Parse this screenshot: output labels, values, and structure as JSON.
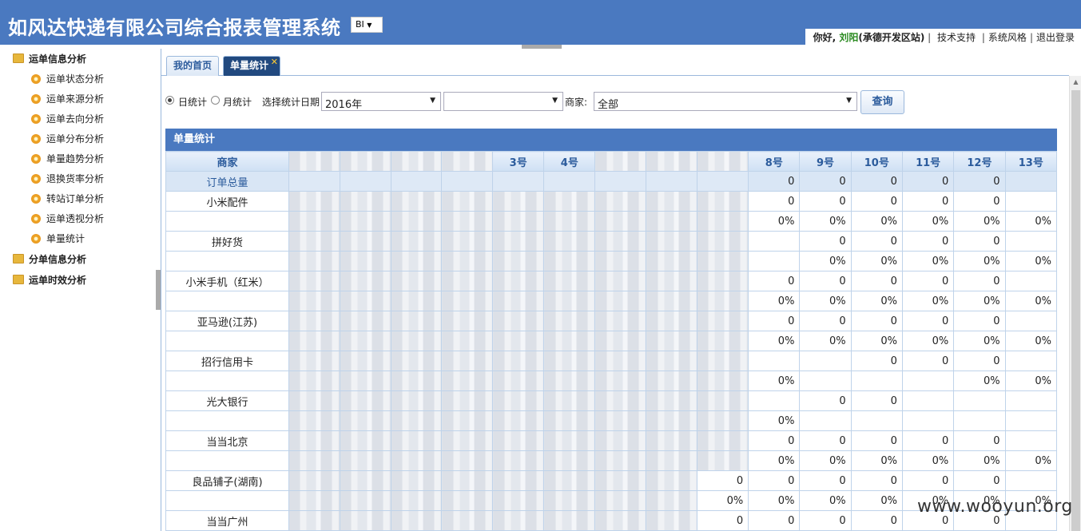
{
  "header": {
    "title": "如风达快递有限公司综合报表管理系统",
    "bi_select": "BI",
    "greeting": "你好, ",
    "user_name": "刘阳",
    "user_site": "(承德开发区站)",
    "links": [
      "技术支持",
      "系统风格",
      "退出登录"
    ]
  },
  "sidebar": {
    "groups": [
      {
        "label": "运单信息分析",
        "items": [
          "运单状态分析",
          "运单来源分析",
          "运单去向分析",
          "运单分布分析",
          "单量趋势分析",
          "退换货率分析",
          "转站订单分析",
          "运单透视分析",
          "单量统计"
        ]
      },
      {
        "label": "分单信息分析",
        "items": []
      },
      {
        "label": "运单时效分析",
        "items": []
      }
    ]
  },
  "tabs": {
    "home": "我的首页",
    "active": "单量统计",
    "close": "✕"
  },
  "filters": {
    "daily": "日统计",
    "monthly": "月统计",
    "date_label": "选择统计日期",
    "year_value": "2016年",
    "month_value": "",
    "merchant_label": "商家:",
    "merchant_value": "全部",
    "query_button": "查询"
  },
  "panel_title": "单量统计",
  "table": {
    "headers": [
      "商家",
      "",
      "",
      "",
      "",
      "3号",
      "4号",
      "",
      "",
      "",
      "8号",
      "9号",
      "10号",
      "11号",
      "12号",
      "13号"
    ],
    "rows": [
      {
        "name": "订单总量",
        "cells": [
          "",
          "",
          "",
          "",
          "",
          "",
          "",
          "",
          "",
          "0",
          "0",
          "0",
          "0",
          "0",
          ""
        ]
      },
      {
        "name": "小米配件",
        "cells": [
          "",
          "",
          "",
          "",
          "",
          "",
          "",
          "",
          "",
          "0",
          "0",
          "0",
          "0",
          "0",
          ""
        ]
      },
      {
        "name": "",
        "cells": [
          "",
          "",
          "",
          "",
          "",
          "",
          "",
          "",
          "",
          "0%",
          "0%",
          "0%",
          "0%",
          "0%",
          "0%"
        ]
      },
      {
        "name": "拼好货",
        "cells": [
          "",
          "",
          "",
          "",
          "",
          "",
          "",
          "",
          "",
          "",
          "0",
          "0",
          "0",
          "0",
          ""
        ]
      },
      {
        "name": "",
        "cells": [
          "",
          "",
          "",
          "",
          "",
          "",
          "",
          "",
          "",
          "",
          "0%",
          "0%",
          "0%",
          "0%",
          "0%"
        ]
      },
      {
        "name": "小米手机（红米）",
        "cells": [
          "",
          "",
          "",
          "",
          "",
          "",
          "",
          "",
          "",
          "0",
          "0",
          "0",
          "0",
          "0",
          ""
        ]
      },
      {
        "name": "",
        "cells": [
          "",
          "",
          "",
          "",
          "",
          "",
          "",
          "",
          "",
          "0%",
          "0%",
          "0%",
          "0%",
          "0%",
          "0%"
        ]
      },
      {
        "name": "亚马逊(江苏)",
        "cells": [
          "",
          "",
          "",
          "",
          "",
          "",
          "",
          "",
          "",
          "0",
          "0",
          "0",
          "0",
          "0",
          ""
        ]
      },
      {
        "name": "",
        "cells": [
          "",
          "",
          "",
          "",
          "",
          "",
          "",
          "",
          "",
          "0%",
          "0%",
          "0%",
          "0%",
          "0%",
          "0%"
        ]
      },
      {
        "name": "招行信用卡",
        "cells": [
          "",
          "",
          "",
          "",
          "",
          "",
          "",
          "",
          "",
          "",
          "",
          "0",
          "0",
          "0",
          ""
        ]
      },
      {
        "name": "",
        "cells": [
          "",
          "",
          "",
          "",
          "",
          "",
          "",
          "",
          "",
          "0%",
          "",
          "",
          "",
          "0%",
          "0%"
        ]
      },
      {
        "name": "光大银行",
        "cells": [
          "",
          "",
          "",
          "",
          "",
          "",
          "",
          "",
          "",
          "",
          "0",
          "0",
          "",
          "",
          ""
        ]
      },
      {
        "name": "",
        "cells": [
          "",
          "",
          "",
          "",
          "",
          "",
          "",
          "",
          "",
          "0%",
          "",
          "",
          "",
          "",
          ""
        ]
      },
      {
        "name": "当当北京",
        "cells": [
          "",
          "",
          "",
          "",
          "",
          "",
          "",
          "",
          "",
          "0",
          "0",
          "0",
          "0",
          "0",
          ""
        ]
      },
      {
        "name": "",
        "cells": [
          "",
          "",
          "",
          "",
          "",
          "",
          "",
          "",
          "",
          "0%",
          "0%",
          "0%",
          "0%",
          "0%",
          "0%"
        ]
      },
      {
        "name": "良品铺子(湖南)",
        "cells": [
          "",
          "",
          "",
          "",
          "",
          "",
          "",
          "",
          "0",
          "0",
          "0",
          "0",
          "0",
          "0",
          ""
        ]
      },
      {
        "name": "",
        "cells": [
          "",
          "",
          "",
          "",
          "",
          "",
          "",
          "",
          "0%",
          "0%",
          "0%",
          "0%",
          "0%",
          "0%",
          "0%"
        ]
      },
      {
        "name": "当当广州",
        "cells": [
          "",
          "",
          "",
          "",
          "",
          "",
          "",
          "",
          "0",
          "0",
          "0",
          "0",
          "0",
          "0",
          ""
        ]
      }
    ]
  },
  "watermark": "www.wooyun.org",
  "colors": {
    "header_bg": "#4a79c0",
    "tab_active": "#21497f",
    "grid": "#bfd3ea"
  }
}
